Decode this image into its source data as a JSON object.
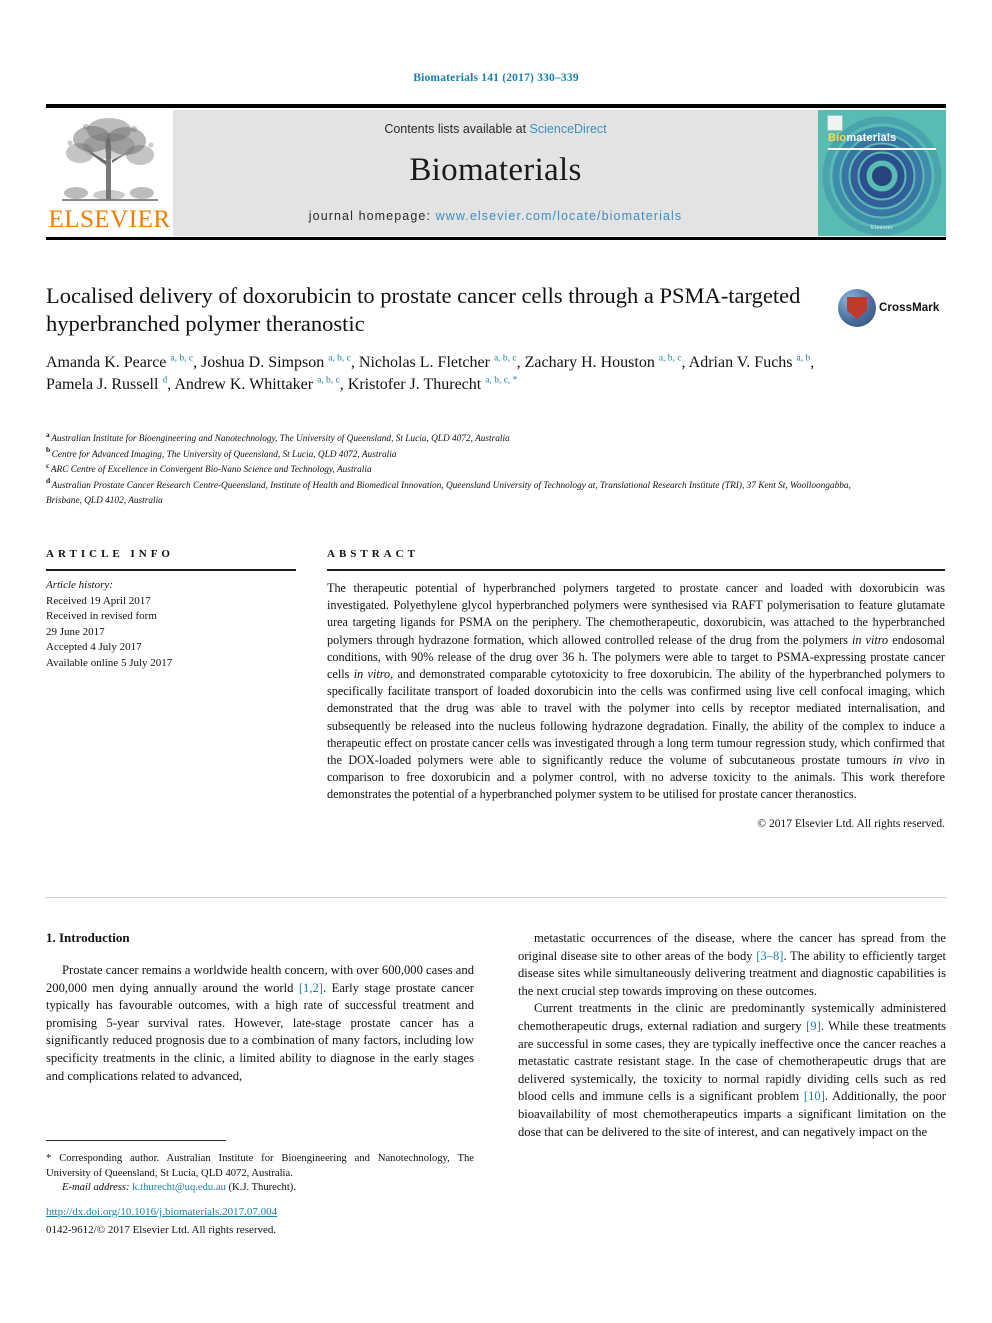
{
  "running_head": "Biomaterials 141 (2017) 330–339",
  "masthead": {
    "contents_prefix": "Contents lists available at ",
    "sciencedirect": "ScienceDirect",
    "journal_name": "Biomaterials",
    "homepage_label": "journal homepage: ",
    "homepage_url": "www.elsevier.com/locate/biomaterials",
    "publisher_logo_text": "ELSEVIER",
    "cover": {
      "title_bio": "Bio",
      "title_materials": "materials",
      "footer": "Elsevier"
    },
    "colors": {
      "link": "#3b8fc4",
      "panel_bg": "#e3e3e3",
      "elsevier_orange": "#f07d00",
      "cover_teal": "#5bbdb4",
      "running_head_blue": "#1a7fa8"
    }
  },
  "title": "Localised delivery of doxorubicin to prostate cancer cells through a PSMA-targeted hyperbranched polymer theranostic",
  "crossmark_label": "CrossMark",
  "authors": [
    {
      "name": "Amanda K. Pearce",
      "marks": "a, b, c",
      "sep": ", "
    },
    {
      "name": "Joshua D. Simpson",
      "marks": "a, b, c",
      "sep": ", "
    },
    {
      "name": "Nicholas L. Fletcher",
      "marks": "a, b, c",
      "sep": ", "
    },
    {
      "name": "Zachary H. Houston",
      "marks": "a, b, c",
      "sep": ", "
    },
    {
      "name": "Adrian V. Fuchs",
      "marks": "a, b",
      "sep": ", "
    },
    {
      "name": "Pamela J. Russell",
      "marks": "d",
      "sep": ", "
    },
    {
      "name": "Andrew K. Whittaker",
      "marks": "a, b, c",
      "sep": ", "
    },
    {
      "name": "Kristofer J. Thurecht",
      "marks": "a, b, c, *",
      "sep": ""
    }
  ],
  "affiliations": [
    {
      "mark": "a",
      "text": "Australian Institute for Bioengineering and Nanotechnology, The University of Queensland, St Lucia, QLD 4072, Australia"
    },
    {
      "mark": "b",
      "text": "Centre for Advanced Imaging, The University of Queensland, St Lucia, QLD 4072, Australia"
    },
    {
      "mark": "c",
      "text": "ARC Centre of Excellence in Convergent Bio-Nano Science and Technology, Australia"
    },
    {
      "mark": "d",
      "text": "Australian Prostate Cancer Research Centre-Queensland, Institute of Health and Biomedical Innovation, Queensland University of Technology at, Translational Research Institute (TRI), 37 Kent St, Woolloongabba, Brisbane, QLD 4102, Australia"
    }
  ],
  "article_info": {
    "heading": "ARTICLE INFO",
    "history_label": "Article history:",
    "history_lines": [
      "Received 19 April 2017",
      "Received in revised form",
      "29 June 2017",
      "Accepted 4 July 2017",
      "Available online 5 July 2017"
    ]
  },
  "abstract": {
    "heading": "ABSTRACT",
    "paragraphs": [
      "The therapeutic potential of hyperbranched polymers targeted to prostate cancer and loaded with doxorubicin was investigated. Polyethylene glycol hyperbranched polymers were synthesised via RAFT polymerisation to feature glutamate urea targeting ligands for PSMA on the periphery. The chemotherapeutic, doxorubicin, was attached to the hyperbranched polymers through hydrazone formation, which allowed controlled release of the drug from the polymers in vitro endosomal conditions, with 90% release of the drug over 36 h. The polymers were able to target to PSMA-expressing prostate cancer cells in vitro, and demonstrated comparable cytotoxicity to free doxorubicin. The ability of the hyperbranched polymers to specifically facilitate transport of loaded doxorubicin into the cells was confirmed using live cell confocal imaging, which demonstrated that the drug was able to travel with the polymer into cells by receptor mediated internalisation, and subsequently be released into the nucleus following hydrazone degradation. Finally, the ability of the complex to induce a therapeutic effect on prostate cancer cells was investigated through a long term tumour regression study, which confirmed that the DOX-loaded polymers were able to significantly reduce the volume of subcutaneous prostate tumours in vivo in comparison to free doxorubicin and a polymer control, with no adverse toxicity to the animals. This work therefore demonstrates the potential of a hyperbranched polymer system to be utilised for prostate cancer theranostics."
    ],
    "copyright": "© 2017 Elsevier Ltd. All rights reserved."
  },
  "introduction": {
    "section_number": "1.",
    "section_title": "Introduction",
    "left_paragraphs": [
      "Prostate cancer remains a worldwide health concern, with over 600,000 cases and 200,000 men dying annually around the world [1,2]. Early stage prostate cancer typically has favourable outcomes, with a high rate of successful treatment and promising 5-year survival rates. However, late-stage prostate cancer has a significantly reduced prognosis due to a combination of many factors, including low specificity treatments in the clinic, a limited ability to diagnose in the early stages and complications related to advanced,"
    ],
    "right_paragraphs": [
      "metastatic occurrences of the disease, where the cancer has spread from the original disease site to other areas of the body [3–8]. The ability to efficiently target disease sites while simultaneously delivering treatment and diagnostic capabilities is the next crucial step towards improving on these outcomes.",
      "Current treatments in the clinic are predominantly systemically administered chemotherapeutic drugs, external radiation and surgery [9]. While these treatments are successful in some cases, they are typically ineffective once the cancer reaches a metastatic castrate resistant stage. In the case of chemotherapeutic drugs that are delivered systemically, the toxicity to normal rapidly dividing cells such as red blood cells and immune cells is a significant problem [10]. Additionally, the poor bioavailability of most chemotherapeutics imparts a significant limitation on the dose that can be delivered to the site of interest, and can negatively impact on the"
    ],
    "citations_left": [
      "[1,2]"
    ],
    "citations_right": [
      "[3–8]",
      "[9]",
      "[10]"
    ]
  },
  "footnote": {
    "star": "*",
    "corresponding": "Corresponding author. Australian Institute for Bioengineering and Nanotechnology, The University of Queensland, St Lucia, QLD 4072, Australia.",
    "email_label": "E-mail address:",
    "email": "k.thurecht@uq.edu.au",
    "email_owner": "(K.J. Thurecht)."
  },
  "footer": {
    "doi": "http://dx.doi.org/10.1016/j.biomaterials.2017.07.004",
    "issn": "0142-9612/© 2017 Elsevier Ltd. All rights reserved."
  }
}
